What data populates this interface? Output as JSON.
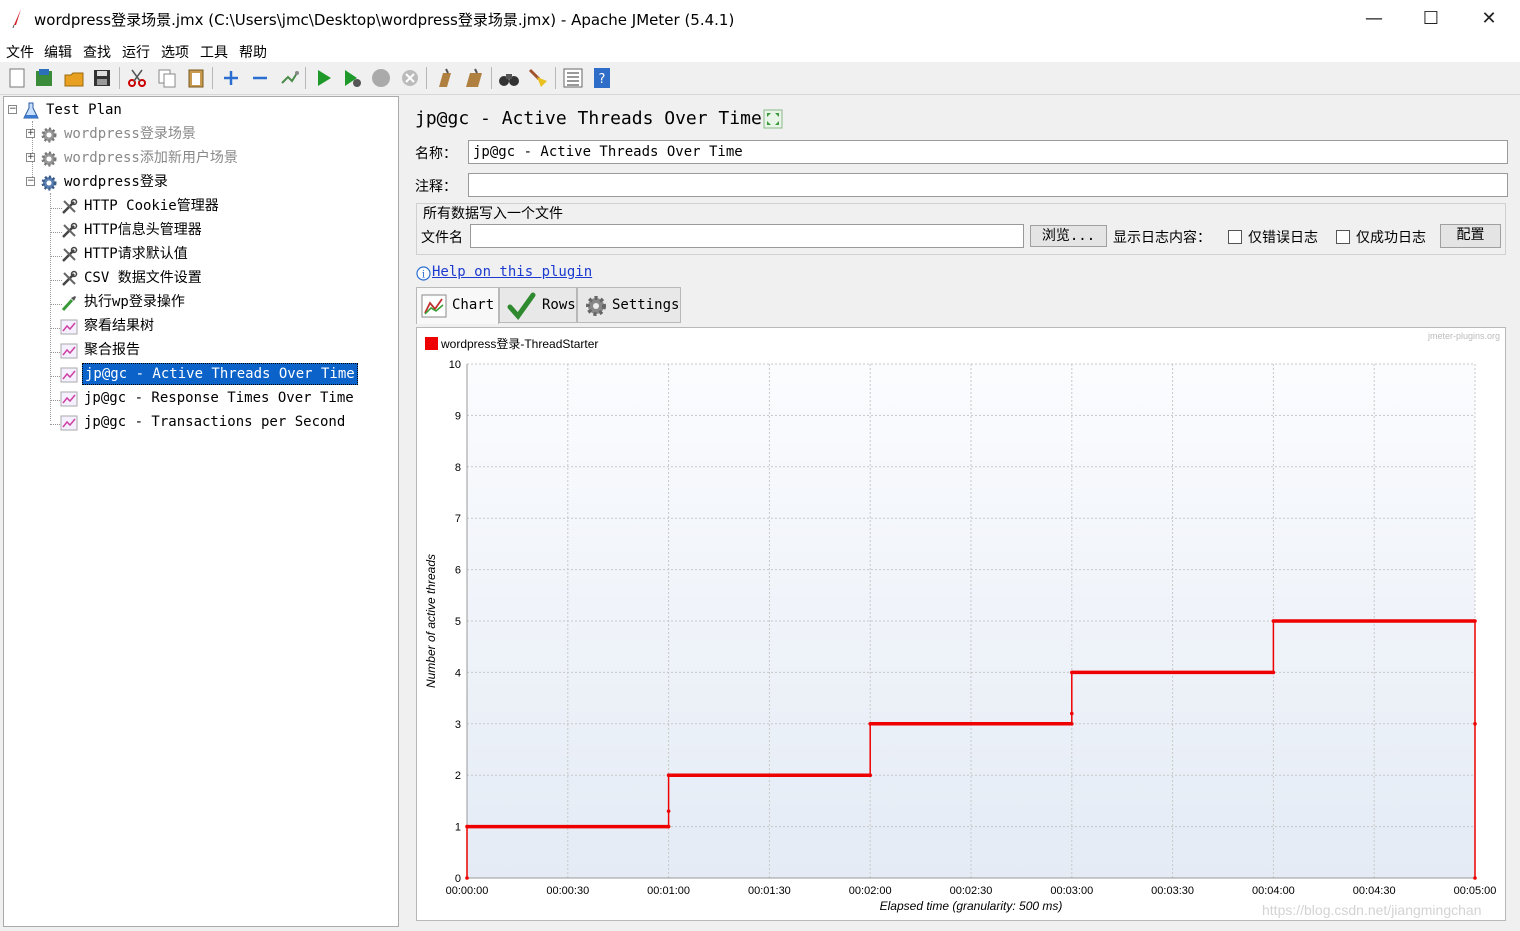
{
  "window": {
    "title": "wordpress登录场景.jmx (C:\\Users\\jmc\\Desktop\\wordpress登录场景.jmx) - Apache JMeter (5.4.1)",
    "minimize": "—",
    "maximize": "☐",
    "close": "✕"
  },
  "menu": [
    "文件",
    "编辑",
    "查找",
    "运行",
    "选项",
    "工具",
    "帮助"
  ],
  "tree": {
    "root": "Test Plan",
    "groups": [
      {
        "label": "wordpress登录场景",
        "disabled": true,
        "expanded": false
      },
      {
        "label": "wordpress添加新用户场景",
        "disabled": true,
        "expanded": false
      },
      {
        "label": "wordpress登录",
        "disabled": false,
        "expanded": true
      }
    ],
    "children": [
      {
        "label": "HTTP Cookie管理器",
        "icon": "wrench-icon"
      },
      {
        "label": "HTTP信息头管理器",
        "icon": "wrench-icon"
      },
      {
        "label": "HTTP请求默认值",
        "icon": "wrench-icon"
      },
      {
        "label": "CSV 数据文件设置",
        "icon": "wrench-icon"
      },
      {
        "label": "执行wp登录操作",
        "icon": "pipette-icon"
      },
      {
        "label": "察看结果树",
        "icon": "graph-icon"
      },
      {
        "label": "聚合报告",
        "icon": "graph-icon"
      },
      {
        "label": "jp@gc - Active Threads Over Time",
        "icon": "graph-icon",
        "selected": true
      },
      {
        "label": "jp@gc - Response Times Over Time",
        "icon": "graph-icon"
      },
      {
        "label": "jp@gc - Transactions per Second",
        "icon": "graph-icon"
      }
    ]
  },
  "panel": {
    "title": "jp@gc - Active Threads Over Time",
    "name_label": "名称：",
    "name_value": "jp@gc - Active Threads Over Time",
    "comment_label": "注释：",
    "comment_value": "",
    "file_section_title": "所有数据写入一个文件",
    "filename_label": "文件名",
    "filename_value": "",
    "browse_button": "浏览...",
    "log_label": "显示日志内容：",
    "errors_only": "仅错误日志",
    "success_only": "仅成功日志",
    "configure_button": "配置",
    "help_link": "Help on this plugin",
    "tabs": [
      "Chart",
      "Rows",
      "Settings"
    ],
    "active_tab": "Chart"
  },
  "chart_data": {
    "type": "line",
    "series": [
      {
        "name": "wordpress登录-ThreadStarter",
        "color": "#ee0000",
        "x": [
          "00:00:00",
          "00:00:00",
          "00:01:00",
          "00:01:00",
          "00:01:00",
          "00:02:00",
          "00:02:00",
          "00:03:00",
          "00:03:00",
          "00:03:00",
          "00:04:00",
          "00:04:00",
          "00:05:00",
          "00:05:00",
          "00:05:00"
        ],
        "values": [
          0,
          1,
          1,
          1.3,
          2,
          2,
          3,
          3,
          3.2,
          4,
          4,
          5,
          5,
          3,
          0
        ]
      }
    ],
    "xlabel": "Elapsed time (granularity: 500 ms)",
    "ylabel": "Number of active threads",
    "x_ticks": [
      "00:00:00",
      "00:00:30",
      "00:01:00",
      "00:01:30",
      "00:02:00",
      "00:02:30",
      "00:03:00",
      "00:03:30",
      "00:04:00",
      "00:04:30",
      "00:05:00"
    ],
    "y_ticks": [
      "0",
      "1",
      "2",
      "3",
      "4",
      "5",
      "6",
      "7",
      "8",
      "9",
      "10"
    ],
    "xlim": [
      "00:00:00",
      "00:05:00"
    ],
    "ylim": [
      0,
      10
    ],
    "grid": true,
    "legend": "top-left",
    "watermark": "jmeter-plugins.org"
  },
  "footer_watermark": "https://blog.csdn.net/jiangmingchan"
}
